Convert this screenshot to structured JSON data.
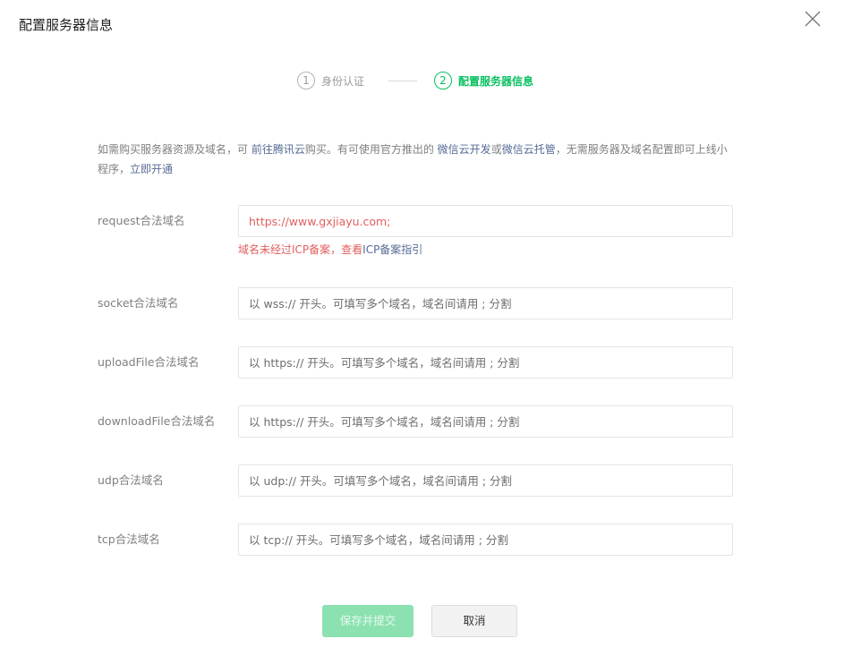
{
  "dialog": {
    "title": "配置服务器信息",
    "close_icon": "close-icon"
  },
  "stepper": {
    "steps": [
      {
        "number": "1",
        "label": "身份认证",
        "active": false
      },
      {
        "number": "2",
        "label": "配置服务器信息",
        "active": true
      }
    ],
    "active_color": "#07c160",
    "inactive_color": "#9a9a9a"
  },
  "intro": {
    "text_1": "如需购买服务器资源及域名，可 ",
    "link_1": "前往腾讯云",
    "text_2": "购买。有可使用官方推出的 ",
    "link_2": "微信云开发",
    "text_3": "或",
    "link_3": "微信云托管",
    "text_4": "，无需服务器及域名配置即可上线小程序，",
    "link_4": "立即开通"
  },
  "fields": [
    {
      "label": "request合法域名",
      "value": "https://www.gxjiayu.com;",
      "placeholder": ""
    },
    {
      "label": "socket合法域名",
      "value": "",
      "placeholder": "以 wss:// 开头。可填写多个域名，域名间请用 ; 分割"
    },
    {
      "label": "uploadFile合法域名",
      "value": "",
      "placeholder": "以 https:// 开头。可填写多个域名，域名间请用 ; 分割"
    },
    {
      "label": "downloadFile合法域名",
      "value": "",
      "placeholder": "以 https:// 开头。可填写多个域名，域名间请用 ; 分割"
    },
    {
      "label": "udp合法域名",
      "value": "",
      "placeholder": "以 udp:// 开头。可填写多个域名，域名间请用 ; 分割"
    },
    {
      "label": "tcp合法域名",
      "value": "",
      "placeholder": "以 tcp:// 开头。可填写多个域名，域名间请用 ; 分割"
    }
  ],
  "error": {
    "text": "域名未经过ICP备案，查看",
    "link": "ICP备案指引",
    "color": "#e15f5f"
  },
  "buttons": {
    "submit_label": "保存并提交",
    "cancel_label": "取消"
  }
}
